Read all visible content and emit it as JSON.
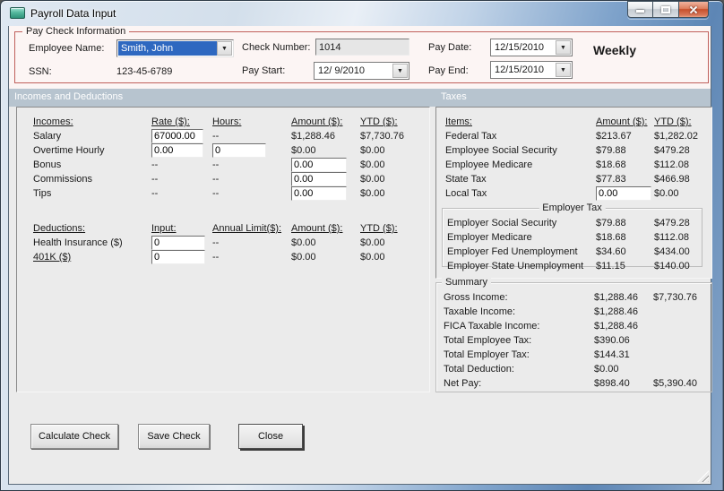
{
  "colors": {
    "header_bar": "#b7c4cf",
    "paycheck_border": "#c0605c",
    "selection_blue": "#2e68c0",
    "client_bg": "#ebebeb",
    "top_panel_bg": "#fcf5f4"
  },
  "window": {
    "title": "Payroll Data Input"
  },
  "paycheck": {
    "group_title": "Pay Check Information",
    "employee_name_label": "Employee Name:",
    "employee_name": "Smith, John",
    "ssn_label": "SSN:",
    "ssn": "123-45-6789",
    "check_number_label": "Check Number:",
    "check_number": "1014",
    "pay_start_label": "Pay Start:",
    "pay_start": "12/ 9/2010",
    "pay_date_label": "Pay Date:",
    "pay_date": "12/15/2010",
    "pay_end_label": "Pay End:",
    "pay_end": "12/15/2010",
    "frequency": "Weekly"
  },
  "incomes_section": {
    "header": "Incomes and Deductions",
    "incomes_headers": {
      "name": "Incomes:",
      "rate": "Rate ($):",
      "hours": "Hours:",
      "amount": "Amount ($):",
      "ytd": "YTD ($):"
    },
    "salary": {
      "label": "Salary",
      "rate": "67000.00",
      "hours": "--",
      "amount": "$1,288.46",
      "ytd": "$7,730.76"
    },
    "overtime": {
      "label": "Overtime Hourly",
      "rate": "0.00",
      "hours": "0",
      "amount": "$0.00",
      "ytd": "$0.00"
    },
    "bonus": {
      "label": "Bonus",
      "rate": "--",
      "hours": "--",
      "amount": "0.00",
      "ytd": "$0.00"
    },
    "commissions": {
      "label": "Commissions",
      "rate": "--",
      "hours": "--",
      "amount": "0.00",
      "ytd": "$0.00"
    },
    "tips": {
      "label": "Tips",
      "rate": "--",
      "hours": "--",
      "amount": "0.00",
      "ytd": "$0.00"
    },
    "deductions_headers": {
      "name": "Deductions:",
      "input": "Input:",
      "limit": "Annual Limit($):",
      "amount": "Amount ($):",
      "ytd": "YTD ($):"
    },
    "health": {
      "label": "Health Insurance  ($)",
      "input": "0",
      "limit": "--",
      "amount": "$0.00",
      "ytd": "$0.00"
    },
    "k401": {
      "label": "401K  ($)",
      "input": "0",
      "limit": "--",
      "amount": "$0.00",
      "ytd": "$0.00"
    }
  },
  "taxes_section": {
    "header": "Taxes",
    "headers": {
      "items": "Items:",
      "amount": "Amount ($):",
      "ytd": "YTD ($):"
    },
    "rows": [
      {
        "label": "Federal Tax",
        "amount": "$213.67",
        "ytd": "$1,282.02"
      },
      {
        "label": "Employee Social Security",
        "amount": "$79.88",
        "ytd": "$479.28"
      },
      {
        "label": "Employee Medicare",
        "amount": "$18.68",
        "ytd": "$112.08"
      },
      {
        "label": "State Tax",
        "amount": "$77.83",
        "ytd": "$466.98"
      }
    ],
    "local_tax": {
      "label": "Local Tax",
      "amount": "0.00",
      "ytd": "$0.00"
    },
    "employer": {
      "group_title": "Employer Tax",
      "rows": [
        {
          "label": "Employer Social Security",
          "amount": "$79.88",
          "ytd": "$479.28"
        },
        {
          "label": "Employer Medicare",
          "amount": "$18.68",
          "ytd": "$112.08"
        },
        {
          "label": "Employer Fed Unemployment",
          "amount": "$34.60",
          "ytd": "$434.00"
        },
        {
          "label": "Employer State Unemployment",
          "amount": "$11.15",
          "ytd": "$140.00"
        }
      ]
    }
  },
  "summary": {
    "group_title": "Summary",
    "rows": [
      {
        "label": "Gross Income:",
        "amount": "$1,288.46",
        "ytd": "$7,730.76"
      },
      {
        "label": "Taxable Income:",
        "amount": "$1,288.46",
        "ytd": ""
      },
      {
        "label": "FICA Taxable Income:",
        "amount": "$1,288.46",
        "ytd": ""
      },
      {
        "label": "Total Employee Tax:",
        "amount": "$390.06",
        "ytd": ""
      },
      {
        "label": "Total Employer Tax:",
        "amount": "$144.31",
        "ytd": ""
      },
      {
        "label": "Total Deduction:",
        "amount": "$0.00",
        "ytd": ""
      },
      {
        "label": "Net Pay:",
        "amount": "$898.40",
        "ytd": "$5,390.40"
      }
    ]
  },
  "buttons": {
    "calculate": "Calculate Check",
    "save": "Save Check",
    "close": "Close"
  }
}
